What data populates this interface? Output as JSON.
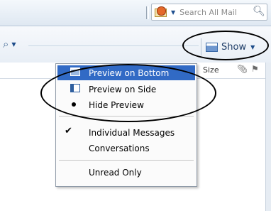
{
  "search": {
    "scope_icon": "mail-scope-icon",
    "placeholder": "Search All Mail",
    "button_icon": "magnifier-icon"
  },
  "toolbar2": {
    "search_icon": "magnifier-icon"
  },
  "show_button": {
    "label": "Show",
    "icon": "preview-pane-icon"
  },
  "columns": {
    "size": "Size",
    "attachment_icon": "paperclip-icon",
    "flag_icon": "flag-icon"
  },
  "menu": {
    "items": [
      {
        "label": "Preview on Bottom",
        "icon": "preview-bottom-icon",
        "highlighted": true
      },
      {
        "label": "Preview on Side",
        "icon": "preview-side-icon"
      },
      {
        "label": "Hide Preview",
        "mark": "bullet"
      },
      {
        "label": "Individual Messages",
        "mark": "check"
      },
      {
        "label": "Conversations"
      },
      {
        "label": "Unread Only"
      }
    ]
  },
  "annotations": {
    "color": "#000000"
  },
  "colors": {
    "menu_highlight": "#316ac5",
    "toolbar": "#e6edf5"
  }
}
